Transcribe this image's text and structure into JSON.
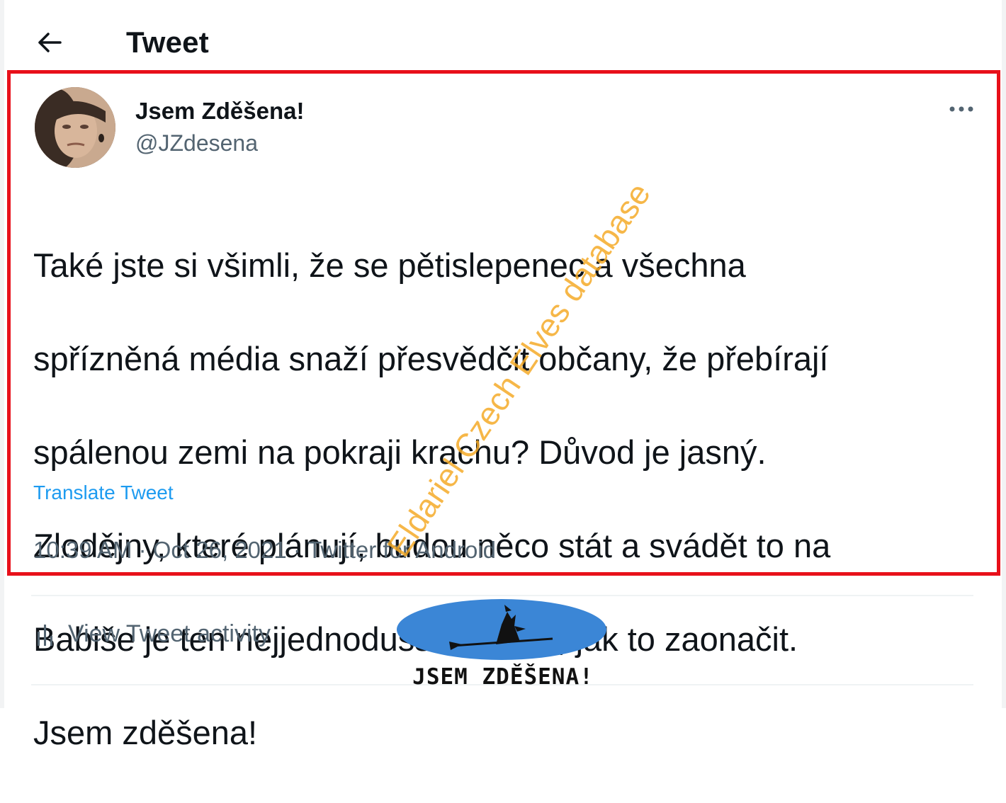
{
  "header": {
    "title": "Tweet"
  },
  "tweet": {
    "display_name": "Jsem Zděšena!",
    "handle": "@JZdesena",
    "text_lines": [
      "Také jste si všimli, že se  pětislepenec a všechna",
      "spřízněná média snaží přesvědčit občany, že přebírají",
      "spálenou zemi na pokraji krachu? Důvod je jasný.",
      "Zlodějny, které plánují, budou něco stát a svádět to na",
      "Babiše je ten nejjednodušší způsob, jak to zaonačit.",
      "Jsem zděšena!"
    ],
    "translate_label": "Translate Tweet",
    "time": "10:39 AM",
    "date": "Oct 26, 2021",
    "source": "Twitter for Android",
    "separator": " · "
  },
  "activity": {
    "label": "View Tweet activity"
  },
  "logo": {
    "text": "JSEM ZDĚŠENA!"
  },
  "watermark": {
    "text": "Eldariel Czech Elves database"
  },
  "colors": {
    "highlight_border": "#e8101a",
    "link": "#1d9bf0",
    "secondary_text": "#536471",
    "logo_blue": "#3b86d6",
    "watermark": "#f4aa28"
  },
  "icons": {
    "back": "arrow-left-icon",
    "more": "more-horizontal-icon",
    "activity": "bar-chart-icon"
  }
}
